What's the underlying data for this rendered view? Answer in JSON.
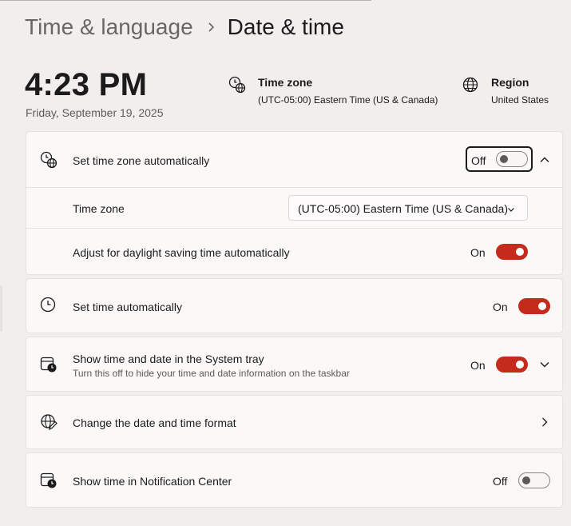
{
  "breadcrumb": {
    "parent": "Time & language",
    "current": "Date & time"
  },
  "clock": {
    "time": "4:23 PM",
    "date": "Friday, September 19, 2025"
  },
  "header_info": {
    "timezone": {
      "title": "Time zone",
      "value": "(UTC-05:00) Eastern Time (US & Canada)",
      "icon": "clock-globe-icon"
    },
    "region": {
      "title": "Region",
      "value": "United States",
      "icon": "globe-icon"
    }
  },
  "settings": {
    "auto_timezone": {
      "label": "Set time zone automatically",
      "state": "Off",
      "icon": "clock-globe-icon",
      "expanded": true
    },
    "timezone_select": {
      "label": "Time zone",
      "value": "(UTC-05:00) Eastern Time (US & Canada)"
    },
    "daylight": {
      "label": "Adjust for daylight saving time automatically",
      "state": "On"
    },
    "auto_time": {
      "label": "Set time automatically",
      "state": "On",
      "icon": "clock-icon"
    },
    "systray": {
      "label": "Show time and date in the System tray",
      "sublabel": "Turn this off to hide your time and date information on the taskbar",
      "state": "On",
      "icon": "calendar-clock-icon"
    },
    "format": {
      "label": "Change the date and time format",
      "icon": "globe-edit-icon"
    },
    "notification": {
      "label": "Show time in Notification Center",
      "state": "Off",
      "icon": "calendar-clock-icon"
    }
  },
  "colors": {
    "accent": "#c42b1c",
    "background": "#f3eeee",
    "card": "#fbf8f8"
  }
}
